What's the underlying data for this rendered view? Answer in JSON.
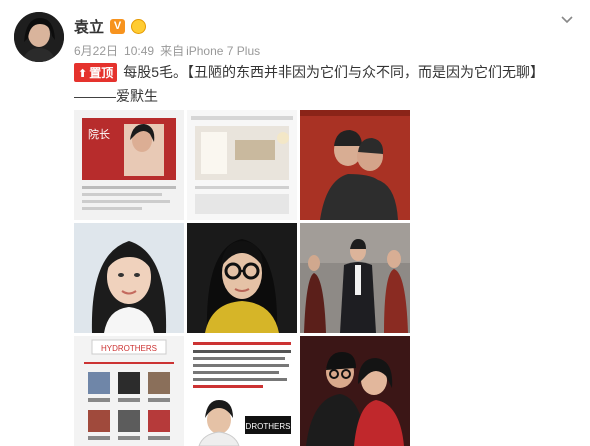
{
  "user": {
    "name": "袁立",
    "vip_badge": "V"
  },
  "meta": {
    "date": "6月22日",
    "time": "10:49",
    "source_prefix": "来自",
    "device": "iPhone 7 Plus"
  },
  "post": {
    "pinned_label": "置顶",
    "text_line1": "每股5毛。【丑陋的东西并非因为它们与众不同，而是因为它们无聊】",
    "text_line2": "———爱默生"
  },
  "images": {
    "count": 9,
    "thumb_texts": {
      "img1_logo": "院长",
      "img7_banner": "HYDROTHERS",
      "img8_banner": "DROTHERS"
    }
  },
  "colors": {
    "pin_red": "#e5322d",
    "vip_orange": "#f7931e",
    "meta_gray": "#999999"
  },
  "icons": [
    "chevron-down-icon",
    "vip-badge-icon",
    "crown-icon",
    "pin-arrow-icon"
  ]
}
